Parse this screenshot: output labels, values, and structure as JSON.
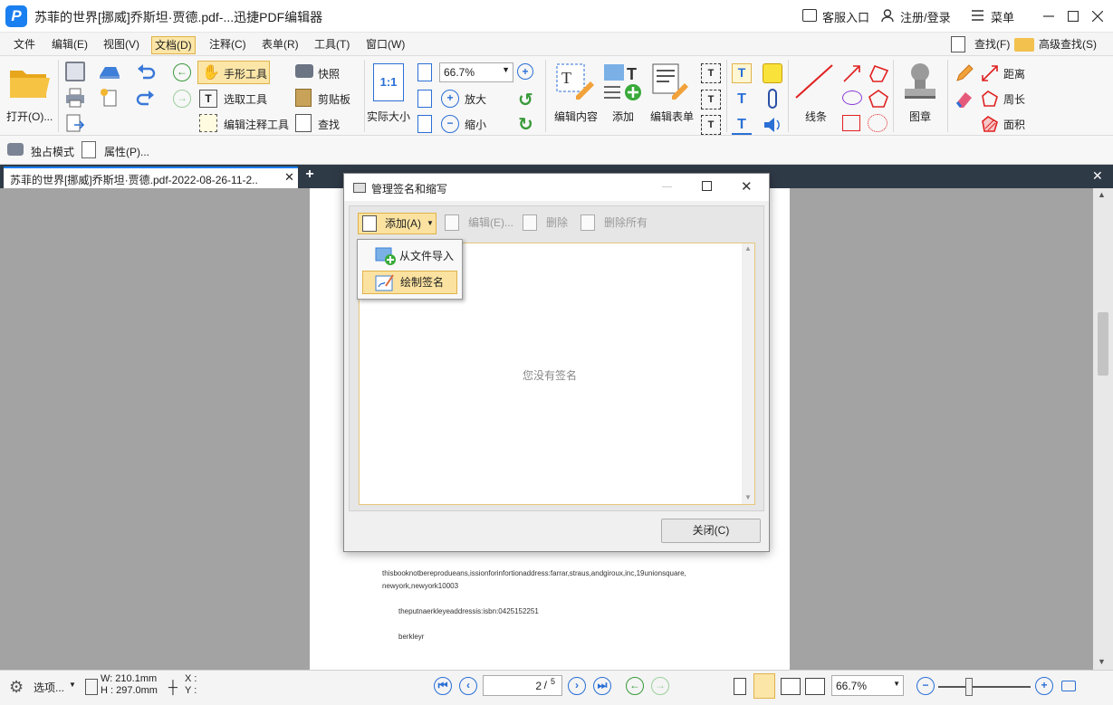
{
  "app": {
    "title": "苏菲的世界[挪威]乔斯坦·贾德.pdf-...迅捷PDF编辑器",
    "logo": "P",
    "service": "客服入口",
    "login": "注册/登录",
    "menu": "菜单"
  },
  "menubar": {
    "items": [
      "文件",
      "编辑(E)",
      "视图(V)",
      "文档(D)",
      "注释(C)",
      "表单(R)",
      "工具(T)",
      "窗口(W)"
    ],
    "find": "查找(F)",
    "advanced_find": "高级查找(S)"
  },
  "ribbon": {
    "open": "打开(O)...",
    "hand_tool": "手形工具",
    "select_tool": "选取工具",
    "edit_annot_tool": "编辑注释工具",
    "snapshot": "快照",
    "clipboard": "剪贴板",
    "find": "查找",
    "actual_size": "实际大小",
    "actual_size_icon": "1:1",
    "zoom_value": "66.7%",
    "zoom_in": "放大",
    "zoom_out": "缩小",
    "edit_content": "编辑内容",
    "add": "添加",
    "edit_form": "编辑表单",
    "line": "线条",
    "stamp": "图章",
    "distance": "距离",
    "perimeter": "周长",
    "area": "面积"
  },
  "subtoolbar": {
    "exclusive_mode": "独占模式",
    "properties": "属性(P)..."
  },
  "tab": {
    "label": "苏菲的世界[挪威]乔斯坦·贾德.pdf-2022-08-26-11-2.."
  },
  "page_text": {
    "line1": "thisbooknotbereprodueans,issionforinfortionaddress:farrar,straus,andgiroux,inc,19unionsquare,",
    "line2": "newyork,newyork10003",
    "line3": "theputnaerkleyeaddressis:isbn:0425152251",
    "line4": "berkleyr"
  },
  "dialog": {
    "title": "管理签名和缩写",
    "add": "添加(A)",
    "edit": "编辑(E)...",
    "delete": "删除",
    "delete_all": "删除所有",
    "empty_message": "您没有签名",
    "close": "关闭(C)",
    "dropdown": {
      "import_from_file": "从文件导入",
      "draw_signature": "绘制签名"
    }
  },
  "statusbar": {
    "options": "选项...",
    "width": "W: 210.1mm",
    "height": "H : 297.0mm",
    "x": "X :",
    "y": "Y :",
    "page": "2",
    "total": "5",
    "zoom": "66.7%"
  },
  "colors": {
    "accent": "#1a7ff0",
    "selected": "#fbe6a8",
    "tabbar": "#2f3a47",
    "workspace": "#a3a3a3"
  }
}
